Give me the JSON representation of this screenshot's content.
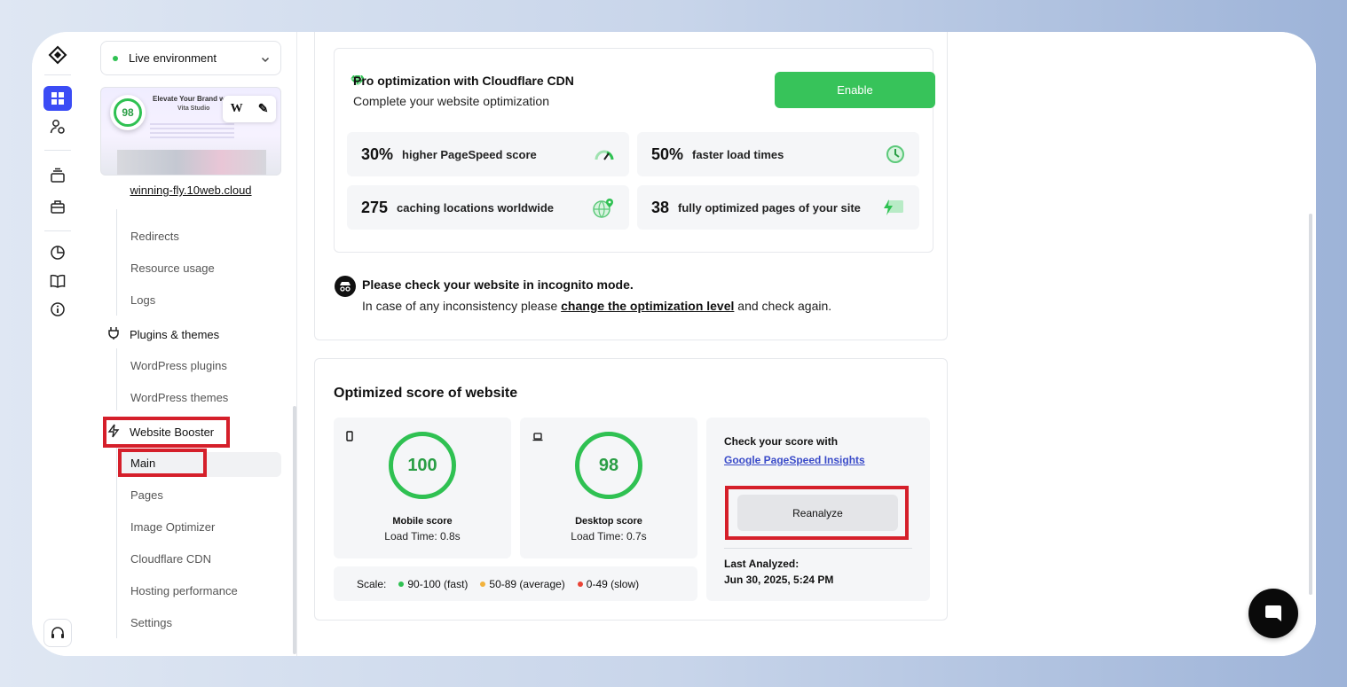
{
  "environment": {
    "label": "Live environment",
    "status_color": "#2fc152"
  },
  "site_preview": {
    "score": "98",
    "headline": "Elevate Your Brand w",
    "subheadline": "Vita Studio",
    "tools": [
      "W",
      "✎"
    ],
    "domain": "winning-fly.10web.cloud"
  },
  "sidebar": {
    "items": [
      {
        "label": "Redirects"
      },
      {
        "label": "Resource usage"
      },
      {
        "label": "Logs"
      }
    ],
    "plugins_section": {
      "label": "Plugins & themes",
      "items": [
        {
          "label": "WordPress plugins"
        },
        {
          "label": "WordPress themes"
        }
      ]
    },
    "booster_section": {
      "label": "Website Booster",
      "items": [
        {
          "label": "Main",
          "selected": true
        },
        {
          "label": "Pages"
        },
        {
          "label": "Image Optimizer"
        },
        {
          "label": "Cloudflare CDN"
        },
        {
          "label": "Hosting performance"
        },
        {
          "label": "Settings"
        }
      ]
    }
  },
  "pro": {
    "title": "Pro optimization with Cloudflare CDN",
    "subtitle": "Complete your website optimization",
    "enable_label": "Enable",
    "stats": [
      {
        "value": "30%",
        "label": "higher PageSpeed score",
        "icon": "speedometer-icon"
      },
      {
        "value": "50%",
        "label": "faster load times",
        "icon": "clock-icon"
      },
      {
        "value": "275",
        "label": "caching locations worldwide",
        "icon": "globe-pin-icon"
      },
      {
        "value": "38",
        "label": "fully optimized pages of your site",
        "icon": "lightning-page-icon"
      }
    ]
  },
  "notice": {
    "title": "Please check your website in incognito mode.",
    "text_before": "In case of any inconsistency please ",
    "link": "change the optimization level",
    "text_after": " and check again."
  },
  "optimized": {
    "title": "Optimized score of website",
    "mobile": {
      "score": "100",
      "label": "Mobile score",
      "load_time": "Load Time: 0.8s"
    },
    "desktop": {
      "score": "98",
      "label": "Desktop score",
      "load_time": "Load Time: 0.7s"
    },
    "scale": {
      "label": "Scale:",
      "fast": "90-100 (fast)",
      "average": "50-89 (average)",
      "slow": "0-49 (slow)",
      "colors": {
        "fast": "#2fc152",
        "average": "#f2b23c",
        "slow": "#ea4335"
      }
    },
    "check": {
      "title": "Check your score with",
      "link": "Google PageSpeed Insights",
      "reanalyze_label": "Reanalyze",
      "last_analyzed_label": "Last Analyzed:",
      "last_analyzed_date": "Jun 30, 2025, 5:24 PM"
    }
  },
  "colors": {
    "accent": "#3b4cf5",
    "success": "#37c35a",
    "highlight": "#d51f2a"
  }
}
